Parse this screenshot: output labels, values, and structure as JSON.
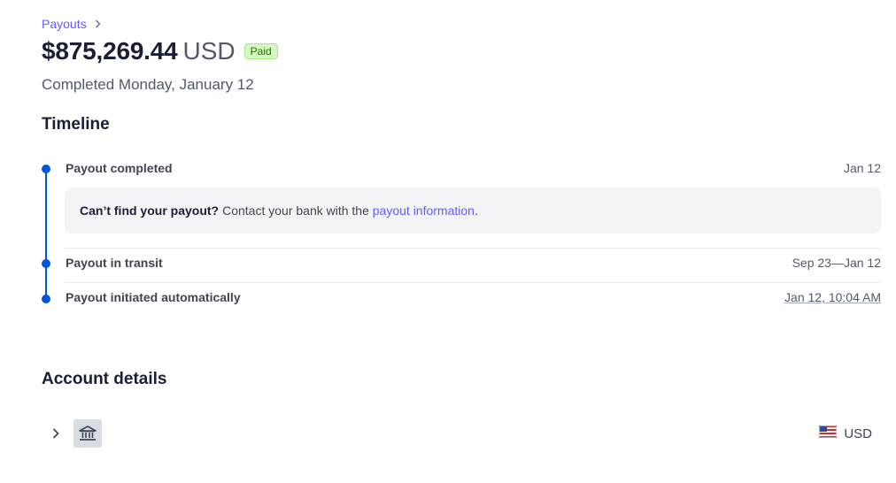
{
  "breadcrumb": {
    "label": "Payouts"
  },
  "header": {
    "amount": "$875,269.44",
    "currency": "USD",
    "status_badge": "Paid",
    "subtitle": "Completed Monday, January 12"
  },
  "timeline": {
    "title": "Timeline",
    "events": [
      {
        "label": "Payout completed",
        "date": "Jan 12"
      },
      {
        "label": "Payout in transit",
        "date": "Sep 23—Jan 12"
      },
      {
        "label": "Payout initiated automatically",
        "date": "Jan 12, 10:04 AM"
      }
    ],
    "callout": {
      "bold": "Can’t find your payout?",
      "text": "Contact your bank with the",
      "link": "payout information",
      "end": "."
    }
  },
  "account": {
    "title": "Account details",
    "currency": "USD",
    "icons": [
      "chevron-right-icon",
      "bank-icon",
      "us-flag-icon"
    ]
  },
  "colors": {
    "accent": "#635bff",
    "timeline": "#0055de",
    "paid_bg": "#d7f7c2",
    "paid_text": "#217005"
  }
}
